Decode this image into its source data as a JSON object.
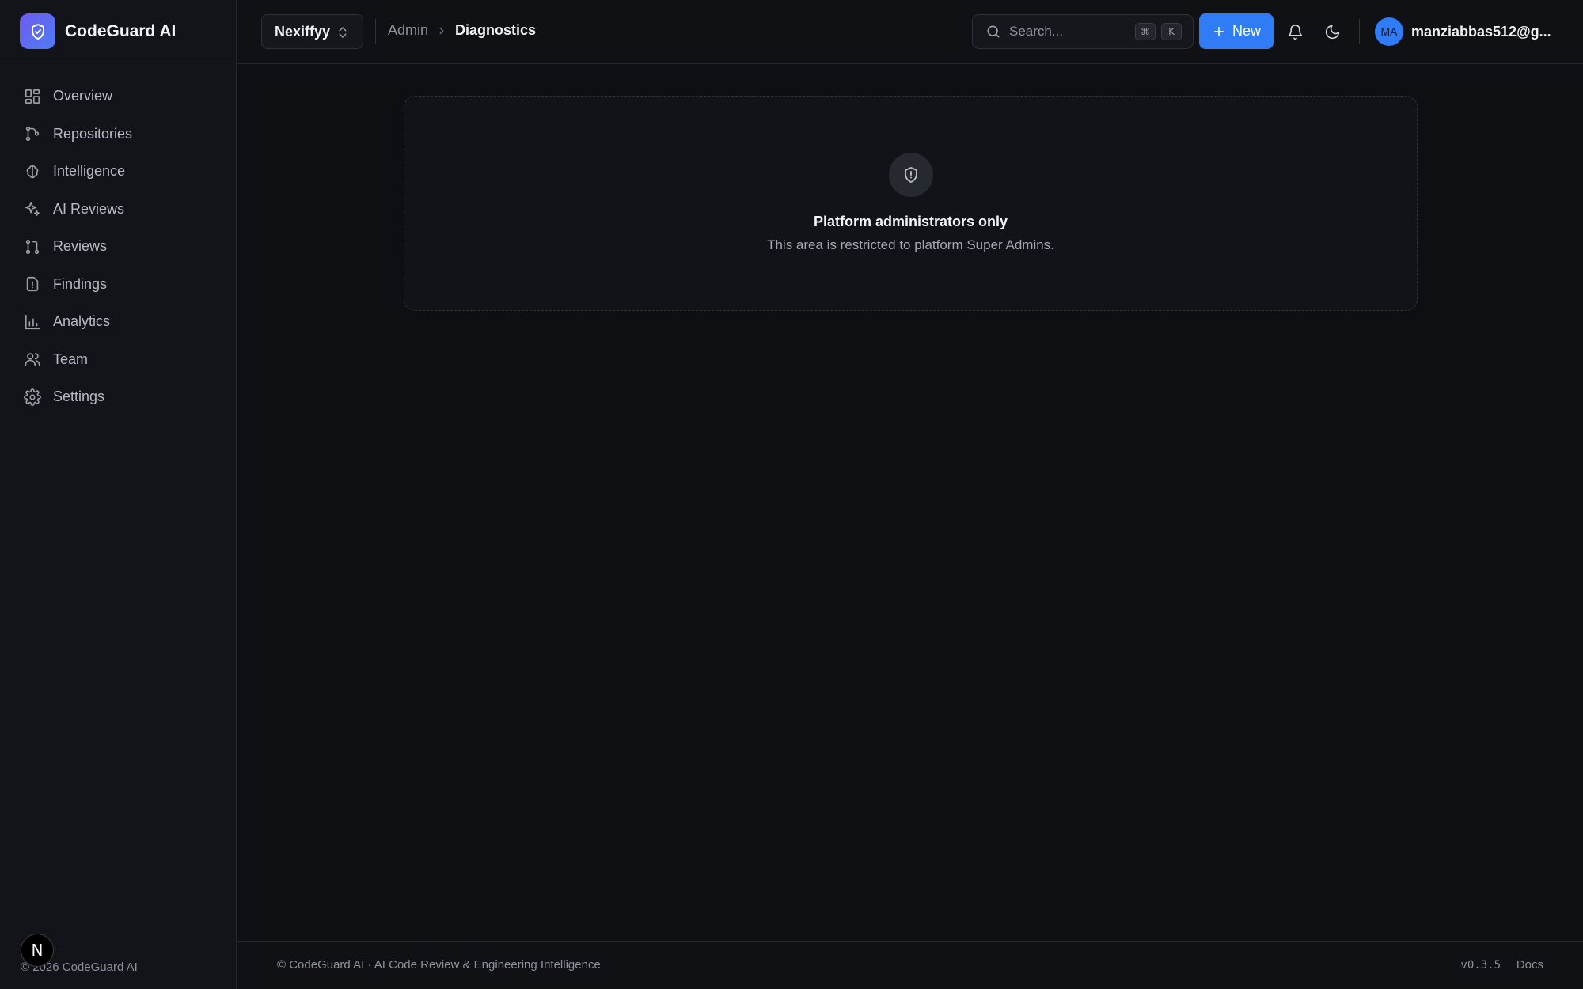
{
  "app": {
    "name": "CodeGuard AI"
  },
  "sidebar": {
    "items": [
      {
        "label": "Overview",
        "icon": "layout-dashboard-icon"
      },
      {
        "label": "Repositories",
        "icon": "git-branch-icon"
      },
      {
        "label": "Intelligence",
        "icon": "brain-icon"
      },
      {
        "label": "AI Reviews",
        "icon": "sparkles-icon"
      },
      {
        "label": "Reviews",
        "icon": "git-pull-request-icon"
      },
      {
        "label": "Findings",
        "icon": "file-alert-icon"
      },
      {
        "label": "Analytics",
        "icon": "bar-chart-icon"
      },
      {
        "label": "Team",
        "icon": "users-icon"
      },
      {
        "label": "Settings",
        "icon": "gear-icon"
      }
    ],
    "footer_text": "© 2026 CodeGuard AI",
    "badge_letter": "N"
  },
  "header": {
    "org_name": "Nexiffyy",
    "breadcrumb": {
      "parent": "Admin",
      "current": "Diagnostics"
    },
    "search": {
      "placeholder": "Search...",
      "shortcut_mod": "⌘",
      "shortcut_key": "K"
    },
    "new_button_label": "New",
    "user": {
      "initials": "MA",
      "email": "manziabbas512@g..."
    }
  },
  "main": {
    "card": {
      "title": "Platform administrators only",
      "description": "This area is restricted to platform Super Admins."
    }
  },
  "footer": {
    "left_text": "© CodeGuard AI · AI Code Review & Engineering Intelligence",
    "version": "v0.3.5",
    "docs_label": "Docs"
  },
  "colors": {
    "accent": "#2f7cf6",
    "brand_gradient_start": "#6d5cf2",
    "brand_gradient_end": "#4f7cf3",
    "background": "#0d0f13",
    "sidebar_bg": "#121419"
  }
}
